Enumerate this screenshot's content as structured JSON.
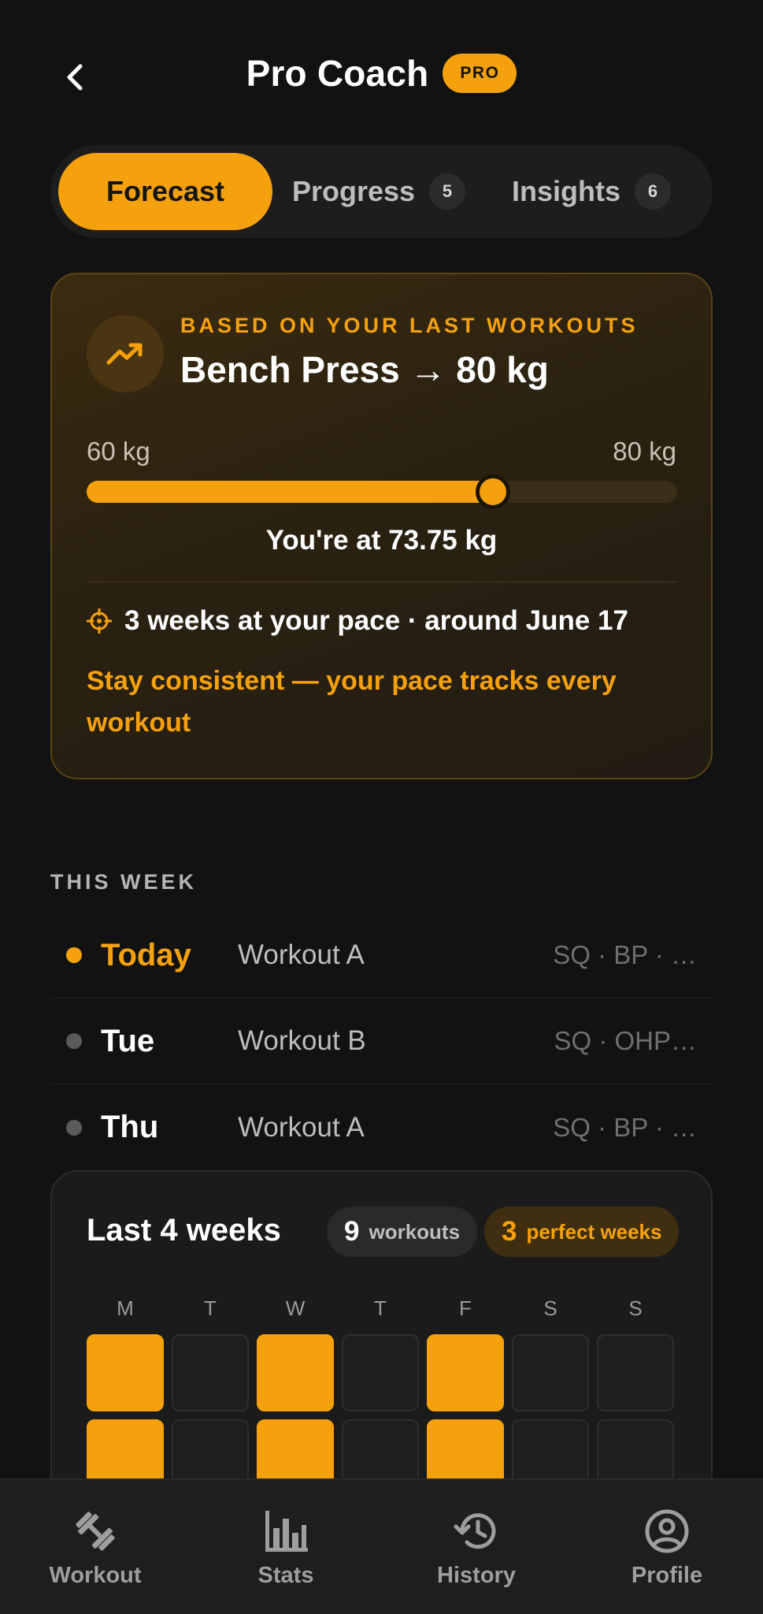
{
  "header": {
    "title": "Pro Coach",
    "badge": "PRO"
  },
  "tabs": [
    {
      "label": "Forecast",
      "count": null,
      "active": true
    },
    {
      "label": "Progress",
      "count": "5",
      "active": false
    },
    {
      "label": "Insights",
      "count": "6",
      "active": false
    }
  ],
  "forecast": {
    "kicker": "BASED ON YOUR LAST WORKOUTS",
    "goal": "Bench Press → 80 kg",
    "range_min": "60 kg",
    "range_max": "80 kg",
    "min_value": 60,
    "max_value": 80,
    "current_value": 73.75,
    "current_text": "You're at 73.75 kg",
    "eta": "3 weeks at your pace · around June 17",
    "advice": "Stay consistent — your pace tracks every workout",
    "icon": "trending-up-icon"
  },
  "this_week": {
    "label": "THIS WEEK",
    "rows": [
      {
        "day": "Today",
        "workout": "Workout A",
        "exercises": "SQ · BP · …",
        "today": true
      },
      {
        "day": "Tue",
        "workout": "Workout B",
        "exercises": "SQ · OHP…",
        "today": false
      },
      {
        "day": "Thu",
        "workout": "Workout A",
        "exercises": "SQ · BP · …",
        "today": false
      }
    ]
  },
  "history": {
    "title": "Last 4 weeks",
    "workouts_count": "9",
    "workouts_label": "workouts",
    "perfect_count": "3",
    "perfect_label": "perfect weeks",
    "weekdays": [
      "M",
      "T",
      "W",
      "T",
      "F",
      "S",
      "S"
    ],
    "grid": [
      [
        true,
        false,
        true,
        false,
        true,
        false,
        false
      ],
      [
        true,
        false,
        true,
        false,
        true,
        false,
        false
      ]
    ]
  },
  "nav": [
    {
      "label": "Workout",
      "icon": "dumbbell-icon"
    },
    {
      "label": "Stats",
      "icon": "bar-chart-icon"
    },
    {
      "label": "History",
      "icon": "history-icon"
    },
    {
      "label": "Profile",
      "icon": "profile-icon"
    }
  ],
  "colors": {
    "accent": "#F5A10E",
    "background": "#121212",
    "card": "#1b1b1b"
  }
}
